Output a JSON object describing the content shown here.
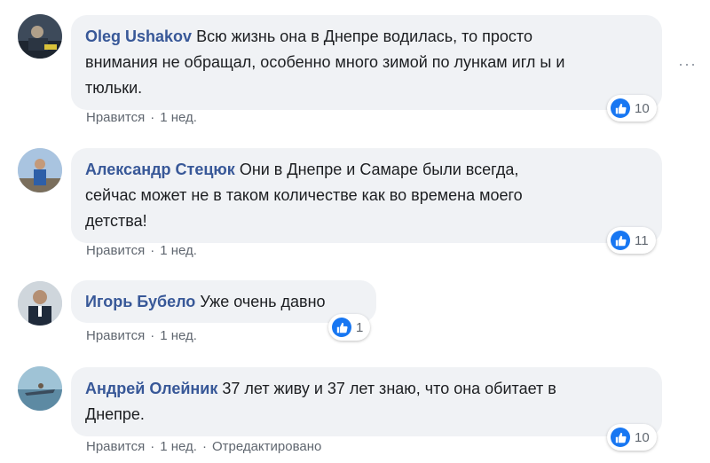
{
  "comments": [
    {
      "author": "Oleg Ushakov",
      "text": "Всю жизнь она в Днепре водилась, то просто внимания не обращал, особенно много зимой по лункам игл ы и тюльки.",
      "line1": "Всю жизнь она в Днепре водилась, то просто",
      "line2": "внимания не обращал, особенно много зимой по лункам игл ы и",
      "line3": "тюльки.",
      "like_action": "Нравится",
      "time": "1 нед.",
      "reactions": "10"
    },
    {
      "author": "Александр Стецюк",
      "line1": "Они в Днепре и Самаре были всегда,",
      "line2": "сейчас может не в таком количестве как во времена моего",
      "line3": "детства!",
      "like_action": "Нравится",
      "time": "1 нед.",
      "reactions": "11"
    },
    {
      "author": "Игорь Бубело",
      "line1": "Уже очень давно",
      "like_action": "Нравится",
      "time": "1 нед.",
      "reactions": "1"
    },
    {
      "author": "Андрей Олейник",
      "line1": "37 лет живу и 37 лет знаю, что она обитает в",
      "line2": "Днепре.",
      "like_action": "Нравится",
      "time": "1 нед.",
      "edited": "Отредактировано",
      "reactions": "10"
    }
  ],
  "icons": {
    "like": "thumbs-up-icon",
    "more": "more-horizontal-icon"
  },
  "colors": {
    "author": "#385898",
    "like_badge": "#1877f2",
    "bubble": "#f0f2f5"
  }
}
